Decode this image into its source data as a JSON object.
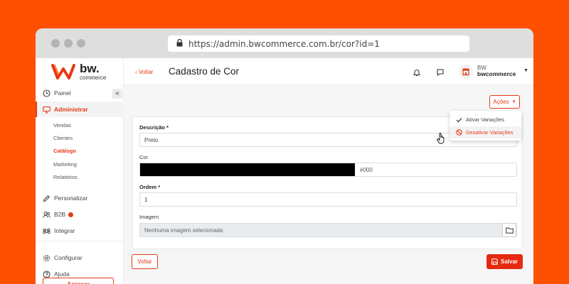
{
  "browser": {
    "url": "https://admin.bwcommerce.com.br/cor?id=1"
  },
  "brand": {
    "name": "bw.",
    "tagline": "commerce"
  },
  "sidebar": {
    "collapse_label": "«",
    "items": [
      {
        "label": "Painel",
        "icon": "clock-icon"
      },
      {
        "label": "Administrar",
        "icon": "monitor-icon"
      },
      {
        "label": "Personalizar",
        "icon": "pencil-icon"
      },
      {
        "label": "B2B",
        "icon": "users-icon"
      },
      {
        "label": "Integrar",
        "icon": "command-icon"
      },
      {
        "label": "Configurar",
        "icon": "gear-icon"
      },
      {
        "label": "Ajuda",
        "icon": "help-icon"
      }
    ],
    "subitems": [
      "Vendas",
      "Clientes",
      "Catálogo",
      "Marketing",
      "Relatórios"
    ],
    "acessar_label": "Acessar"
  },
  "header": {
    "back_label": "Voltar",
    "title": "Cadastro de Cor",
    "user_line1": "BW",
    "user_line2": "bwcommerce"
  },
  "actions": {
    "label": "Ações",
    "menu": [
      "Ativar Variações",
      "Desativar Variações"
    ]
  },
  "form": {
    "descricao_label": "Descrição *",
    "descricao_value": "Preto",
    "cor_label": "Cor",
    "cor_value": "#000",
    "ordem_label": "Ordem *",
    "ordem_value": "1",
    "imagem_label": "Imagem",
    "imagem_placeholder": "Nenhuma imagem selecionada"
  },
  "buttons": {
    "voltar": "Voltar",
    "salvar": "Salvar"
  },
  "colors": {
    "accent": "#e53a15",
    "background": "#ff4f00",
    "swatch": "#000000"
  }
}
